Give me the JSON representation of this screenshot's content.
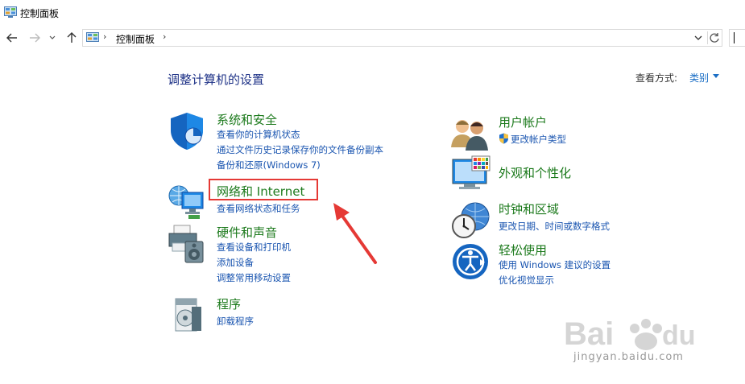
{
  "window": {
    "title": "控制面板"
  },
  "address": {
    "crumb": "控制面板",
    "sep": "›"
  },
  "main": {
    "heading": "调整计算机的设置",
    "view_by_label": "查看方式:",
    "view_by_value": "类别"
  },
  "categories": {
    "system": {
      "title": "系统和安全",
      "links": [
        "查看你的计算机状态",
        "通过文件历史记录保存你的文件备份副本",
        "备份和还原(Windows 7)"
      ]
    },
    "network": {
      "title": "网络和 Internet",
      "links": [
        "查看网络状态和任务"
      ]
    },
    "hardware": {
      "title": "硬件和声音",
      "links": [
        "查看设备和打印机",
        "添加设备",
        "调整常用移动设置"
      ]
    },
    "programs": {
      "title": "程序",
      "links": [
        "卸载程序"
      ]
    },
    "users": {
      "title": "用户帐户",
      "links": [
        "更改帐户类型"
      ]
    },
    "appearance": {
      "title": "外观和个性化",
      "links": []
    },
    "clock": {
      "title": "时钟和区域",
      "links": [
        "更改日期、时间或数字格式"
      ]
    },
    "ease": {
      "title": "轻松使用",
      "links": [
        "使用 Windows 建议的设置",
        "优化视觉显示"
      ]
    }
  },
  "watermark": {
    "brand": "Bai du 经验",
    "url": "jingyan.baidu.com"
  },
  "colors": {
    "title_green": "#1c7a1c",
    "link_blue": "#1a55b0",
    "heading_blue": "#1e3287",
    "highlight_red": "#e53935"
  }
}
